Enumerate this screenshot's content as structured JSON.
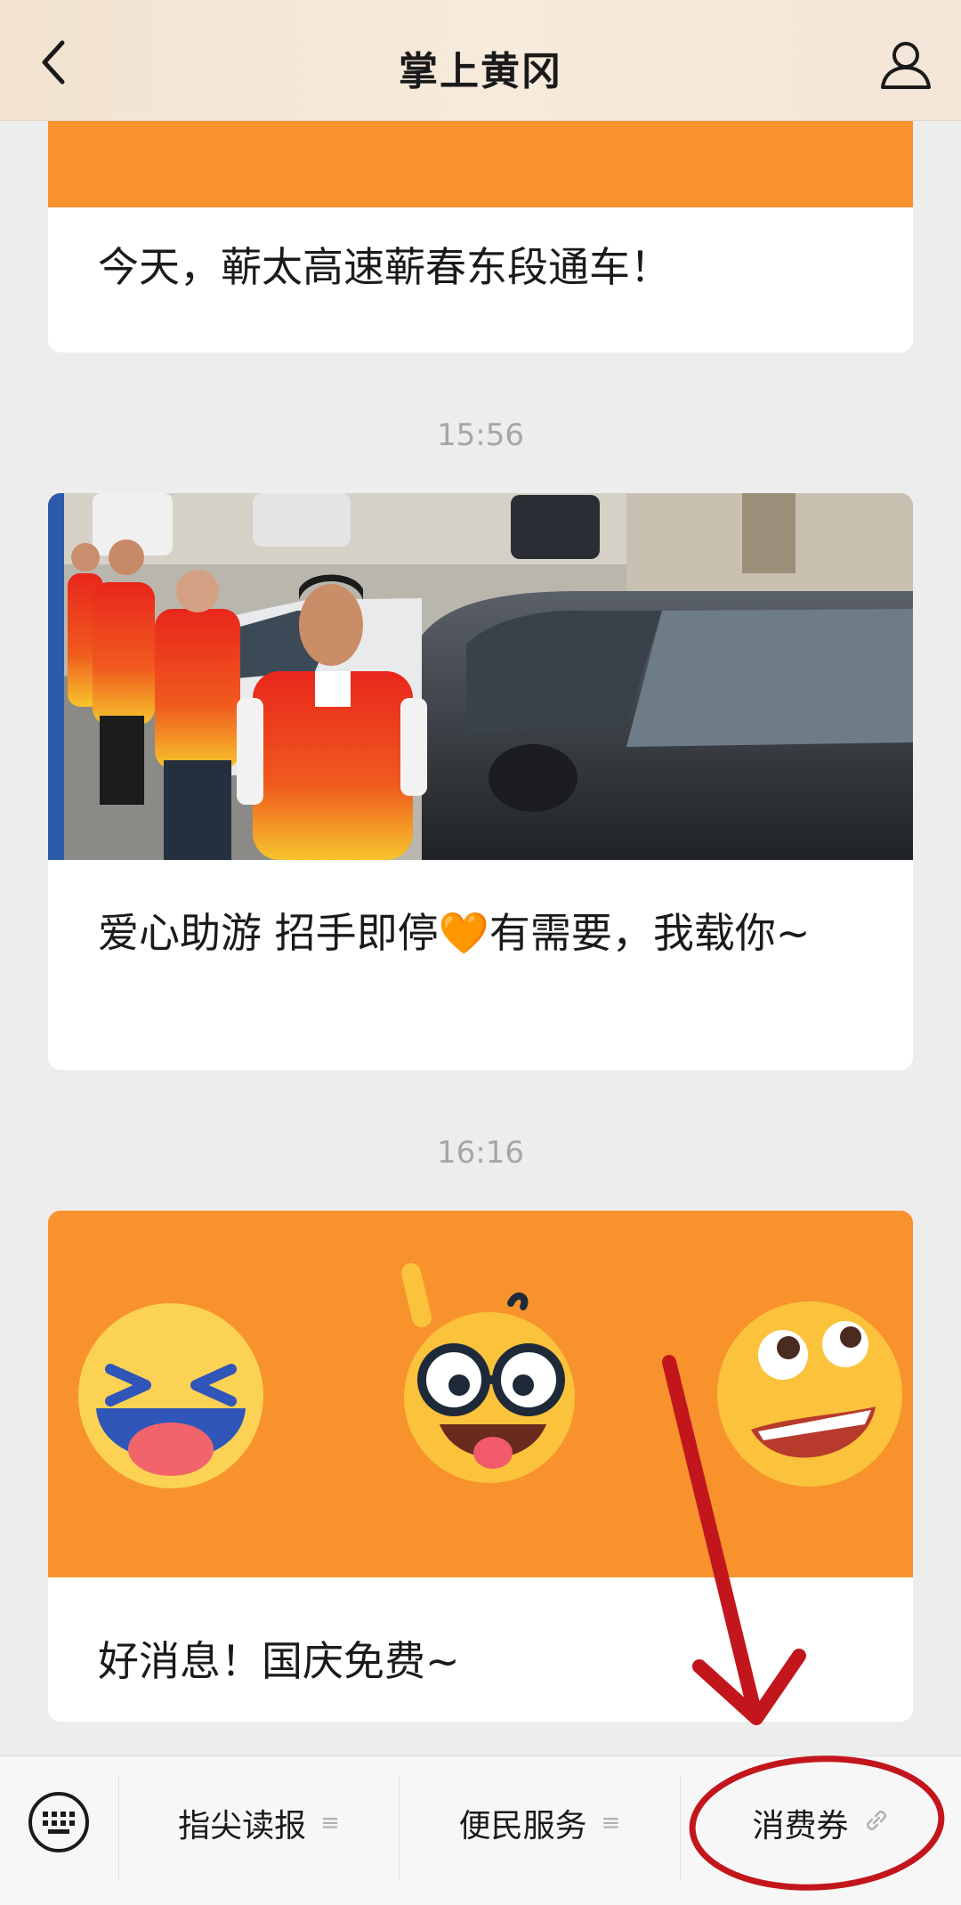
{
  "header": {
    "title": "掌上黄冈"
  },
  "feed": {
    "messages": [
      {
        "title": "今天，蕲太高速蕲春东段通车！"
      },
      {
        "time": "15:56",
        "title": "爱心助游 招手即停🧡有需要，我载你~"
      },
      {
        "time": "16:16",
        "title": "好消息！国庆免费~"
      }
    ]
  },
  "menu": {
    "items": [
      {
        "label": "指尖读报",
        "icon": "list-icon"
      },
      {
        "label": "便民服务",
        "icon": "list-icon"
      },
      {
        "label": "消费券",
        "icon": "link-icon"
      }
    ]
  },
  "colors": {
    "accent_orange": "#f7922d",
    "annotation_red": "#c3161c",
    "header_bg": "#f4e6d6"
  }
}
